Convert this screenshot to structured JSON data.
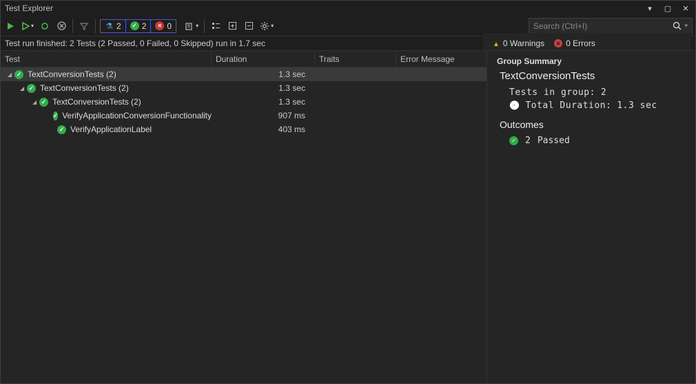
{
  "title": "Test Explorer",
  "search": {
    "placeholder": "Search (Ctrl+I)"
  },
  "counters": {
    "total": "2",
    "passed": "2",
    "failed": "0"
  },
  "status": {
    "text": "Test run finished: 2 Tests (2 Passed, 0 Failed, 0 Skipped) run in 1.7 sec",
    "warnings": "0 Warnings",
    "errors": "0 Errors"
  },
  "columns": {
    "test": "Test",
    "duration": "Duration",
    "traits": "Traits",
    "error": "Error Message"
  },
  "rows": [
    {
      "indent": 10,
      "caret": true,
      "icon": "pass",
      "name": "TextConversionTests  (2)",
      "dur": "1.3 sec",
      "sel": true
    },
    {
      "indent": 28,
      "caret": true,
      "icon": "pass",
      "name": "TextConversionTests  (2)",
      "dur": "1.3 sec"
    },
    {
      "indent": 46,
      "caret": true,
      "icon": "pass",
      "name": "TextConversionTests  (2)",
      "dur": "1.3 sec"
    },
    {
      "indent": 72,
      "caret": false,
      "icon": "pass",
      "name": "VerifyApplicationConversionFunctionality",
      "dur": "907 ms"
    },
    {
      "indent": 72,
      "caret": false,
      "icon": "pass",
      "name": "VerifyApplicationLabel",
      "dur": "403 ms"
    }
  ],
  "summary": {
    "header": "Group Summary",
    "name": "TextConversionTests",
    "count_label": "Tests in group:",
    "count": "2",
    "duration_label": "Total Duration:",
    "duration": "1.3 sec",
    "outcomes_label": "Outcomes",
    "passed_count": "2",
    "passed_label": "Passed"
  }
}
